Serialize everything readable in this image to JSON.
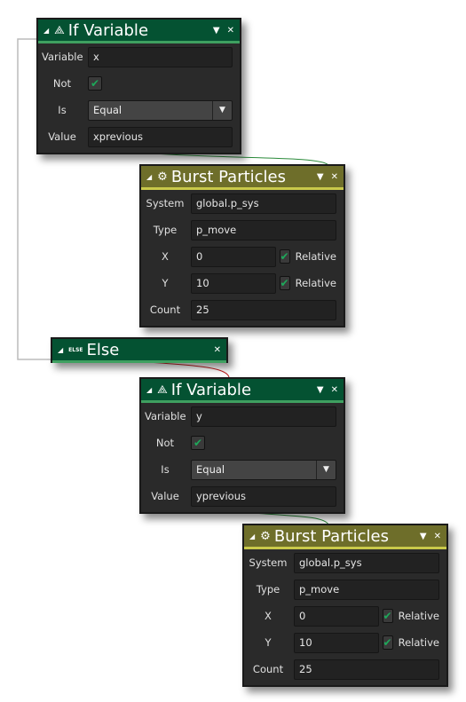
{
  "colors": {
    "if_header": "#045232",
    "particles_header": "#6e6e2a",
    "check": "#1ea85a"
  },
  "blocks": [
    {
      "type": "if",
      "title": "If Variable",
      "icon": "if-variable-icon",
      "fields": {
        "variable_label": "Variable",
        "variable": "x",
        "not_label": "Not",
        "not_checked": true,
        "is_label": "Is",
        "is": "Equal",
        "value_label": "Value",
        "value": "xprevious"
      }
    },
    {
      "type": "burst",
      "title": "Burst Particles",
      "icon": "burst-particles-icon",
      "fields": {
        "system_label": "System",
        "system": "global.p_sys",
        "type_label": "Type",
        "type": "p_move",
        "x_label": "X",
        "x": "0",
        "x_relative": true,
        "y_label": "Y",
        "y": "10",
        "y_relative": true,
        "relative_label": "Relative",
        "count_label": "Count",
        "count": "25"
      }
    },
    {
      "type": "else",
      "title": "Else",
      "icon_text": "ELSE"
    },
    {
      "type": "if",
      "title": "If Variable",
      "icon": "if-variable-icon",
      "fields": {
        "variable_label": "Variable",
        "variable": "y",
        "not_label": "Not",
        "not_checked": true,
        "is_label": "Is",
        "is": "Equal",
        "value_label": "Value",
        "value": "yprevious"
      }
    },
    {
      "type": "burst",
      "title": "Burst Particles",
      "icon": "burst-particles-icon",
      "fields": {
        "system_label": "System",
        "system": "global.p_sys",
        "type_label": "Type",
        "type": "p_move",
        "x_label": "X",
        "x": "0",
        "x_relative": true,
        "y_label": "Y",
        "y": "10",
        "y_relative": true,
        "relative_label": "Relative",
        "count_label": "Count",
        "count": "25"
      }
    }
  ]
}
